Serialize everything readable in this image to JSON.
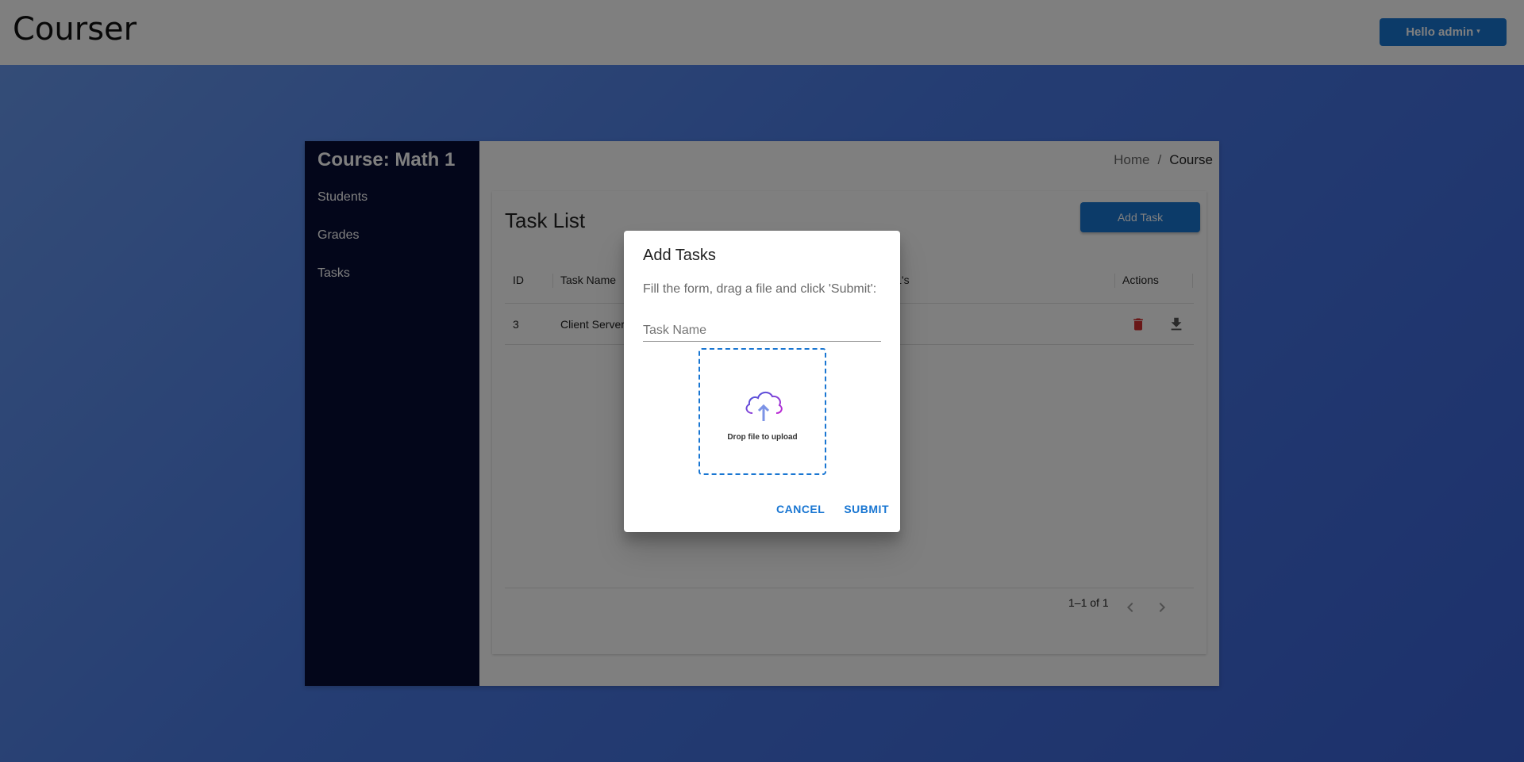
{
  "navbar": {
    "brand": "Courser",
    "user_menu_label": "Hello admin",
    "caret": "▾"
  },
  "sidebar": {
    "course_title": "Course: Math 1",
    "items": [
      {
        "label": "Students"
      },
      {
        "label": "Grades"
      },
      {
        "label": "Tasks"
      }
    ]
  },
  "breadcrumb": {
    "home": "Home",
    "separator": "/",
    "current": "Course"
  },
  "task_list": {
    "title": "Task List",
    "add_button": "Add Task",
    "columns": [
      "ID",
      "Task Name",
      "RL's",
      "Actions"
    ],
    "rows": [
      {
        "id": "3",
        "task_name": "Client Server"
      }
    ],
    "pagination": "1–1 of 1"
  },
  "dialog": {
    "title": "Add Tasks",
    "instructions": "Fill the form, drag a file and click 'Submit':",
    "task_name_placeholder": "Task Name",
    "dropzone_text": "Drop file to upload",
    "cancel_label": "CANCEL",
    "submit_label": "SUBMIT"
  },
  "colors": {
    "primary": "#1976d2",
    "sidebar_bg": "#070c34",
    "delete_icon": "#d32f2f"
  },
  "icons": [
    "caret-down-icon",
    "delete-icon",
    "download-icon",
    "chevron-left-icon",
    "chevron-right-icon",
    "cloud-upload-icon"
  ]
}
